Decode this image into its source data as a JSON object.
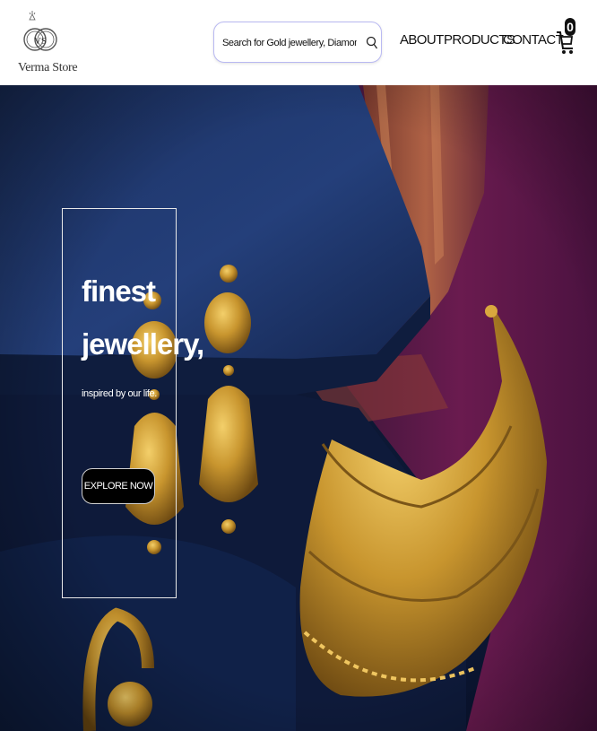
{
  "brand": {
    "logo_text": "Verma Store",
    "monogram": "VS"
  },
  "search": {
    "placeholder": "Search for Gold jewellery, Diamond..."
  },
  "nav": {
    "items": [
      {
        "label": "ABOUT"
      },
      {
        "label": "PRODUCTS"
      },
      {
        "label": "CONTACT"
      }
    ]
  },
  "cart": {
    "count": "0"
  },
  "hero": {
    "title_line1": "finest",
    "title_line2": "jewellery,",
    "subtitle": "inspired by our life.",
    "cta_label": "EXPLORE NOW"
  },
  "colors": {
    "hero_bg": "#0c1733",
    "cloth_purple": "#5a1542",
    "gold": "#c8952e"
  }
}
